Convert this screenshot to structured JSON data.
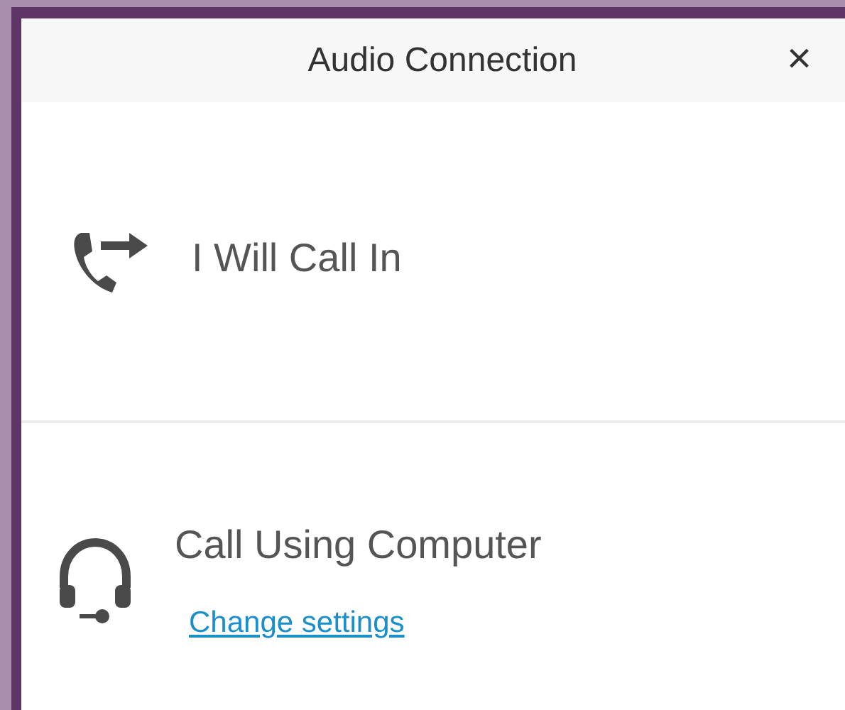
{
  "window": {
    "title": "Audio Connection",
    "close": "×"
  },
  "options": [
    {
      "kind": "call-in",
      "label": "I Will Call In"
    },
    {
      "kind": "computer",
      "label": "Call Using Computer",
      "link": "Change settings"
    }
  ]
}
